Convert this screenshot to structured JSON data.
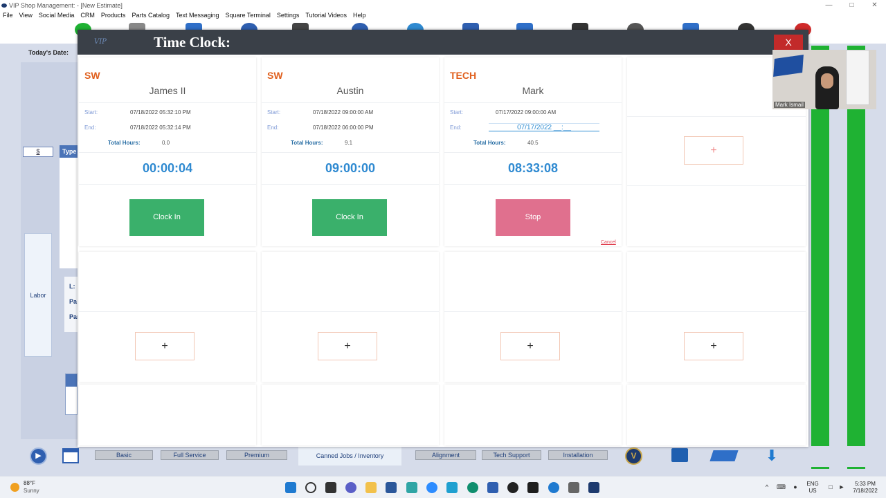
{
  "window": {
    "title": "VIP Shop Management: - [New Estimate]"
  },
  "menu": [
    "File",
    "View",
    "Social Media",
    "CRM",
    "Products",
    "Parts Catalog",
    "Text Messaging",
    "Square Terminal",
    "Settings",
    "Tutorial Videos",
    "Help"
  ],
  "app": {
    "todays_date_label": "Today's Date:",
    "dollar_label": "$",
    "type_label": "Type",
    "labor_label": "Labor",
    "l_label": "L:",
    "pa_label": "Pa",
    "par_label": "Par"
  },
  "bottom_tabs": [
    "Basic",
    "Full Service",
    "Premium",
    "Canned Jobs / Inventory",
    "Alignment",
    "Tech Support",
    "Installation"
  ],
  "modal": {
    "logo": "VIP",
    "title": "Time Clock:",
    "close_label": "X",
    "labels": {
      "start": "Start:",
      "end": "End:",
      "total_hours": "Total Hours:"
    },
    "employees": [
      {
        "role": "SW",
        "name": "James II",
        "start": "07/18/2022 05:32:10 PM",
        "end": "07/18/2022 05:32:14 PM",
        "total_hours": "0.0",
        "timer": "00:00:04",
        "action": "Clock In"
      },
      {
        "role": "SW",
        "name": "Austin",
        "start": "07/18/2022 09:00:00 AM",
        "end": "07/18/2022 06:00:00 PM",
        "total_hours": "9.1",
        "timer": "09:00:00",
        "action": "Clock In"
      },
      {
        "role": "TECH",
        "name": "Mark",
        "start": "07/17/2022 09:00:00 AM",
        "end": "07/17/2022 __:__",
        "total_hours": "40.5",
        "timer": "08:33:08",
        "action": "Stop",
        "cancel": "Cancel"
      }
    ],
    "add_label": "+"
  },
  "webcam": {
    "name": "Mark Ismail"
  },
  "taskbar": {
    "weather_temp": "88°F",
    "weather_desc": "Sunny",
    "lang_top": "ENG",
    "lang_bottom": "US",
    "time": "5:33 PM",
    "date": "7/18/2022"
  }
}
